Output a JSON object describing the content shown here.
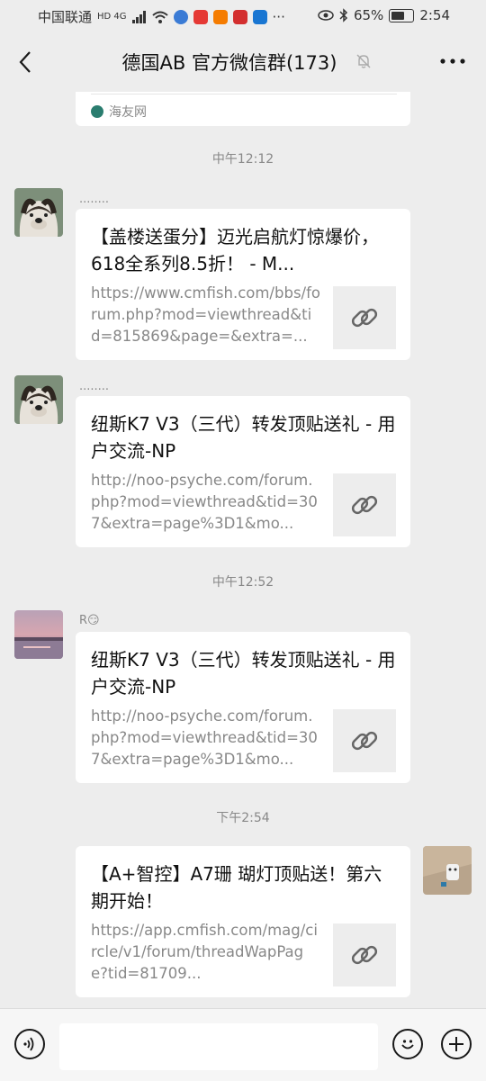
{
  "status_bar": {
    "carrier": "中国联通",
    "network_badges": "HD 4G",
    "battery_percent": "65%",
    "time": "2:54"
  },
  "header": {
    "title": "德国AB  官方微信群(173)"
  },
  "messages": {
    "top_partial_source": "海友网",
    "time_1": "中午12:12",
    "msg1": {
      "nickname": "........",
      "title": "【盖楼送蛋分】迈光启航灯惊爆价，618全系列8.5折！ - M...",
      "url": "https://www.cmfish.com/bbs/forum.php?mod=viewthread&tid=815869&page=&extra=..."
    },
    "msg2": {
      "nickname": "........",
      "title": "纽斯K7 V3（三代）转发顶贴送礼 - 用户交流-NP",
      "url": "http://noo-psyche.com/forum.php?mod=viewthread&tid=307&extra=page%3D1&mo..."
    },
    "time_2": "中午12:52",
    "msg3": {
      "nickname": "R😏",
      "title": "纽斯K7 V3（三代）转发顶贴送礼 - 用户交流-NP",
      "url": "http://noo-psyche.com/forum.php?mod=viewthread&tid=307&extra=page%3D1&mo..."
    },
    "time_3": "下午2:54",
    "msg4": {
      "title": "【A+智控】A7珊 瑚灯顶贴送！第六期开始！",
      "url": "https://app.cmfish.com/mag/circle/v1/forum/threadWapPage?tid=81709..."
    }
  },
  "input": {
    "placeholder": ""
  }
}
